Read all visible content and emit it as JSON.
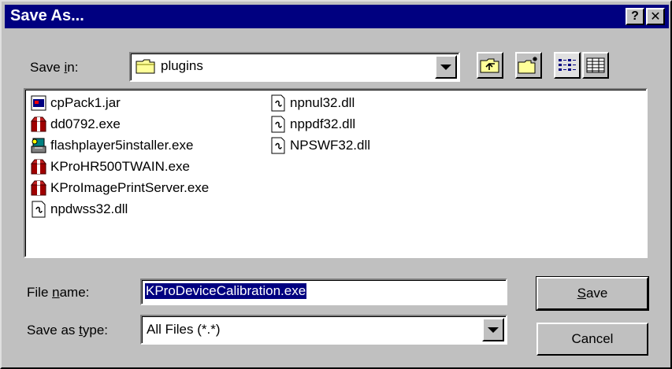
{
  "window": {
    "title": "Save As...",
    "help_button": "?",
    "close_button": "✕"
  },
  "save_in": {
    "label_pre": "Save ",
    "label_mnemonic": "i",
    "label_post": "n:",
    "folder": "plugins",
    "folder_icon": "folder-icon"
  },
  "toolbar": [
    {
      "name": "up-one-level-button",
      "icon": "up-folder-icon"
    },
    {
      "name": "create-new-folder-button",
      "icon": "new-folder-icon"
    },
    {
      "name": "list-view-button",
      "icon": "list-view-icon"
    },
    {
      "name": "details-view-button",
      "icon": "details-view-icon"
    }
  ],
  "files": [
    {
      "name": "cpPack1.jar",
      "icon": "jar-icon"
    },
    {
      "name": "dd0792.exe",
      "icon": "package-icon"
    },
    {
      "name": "flashplayer5installer.exe",
      "icon": "installer-icon"
    },
    {
      "name": "KProHR500TWAIN.exe",
      "icon": "package-icon"
    },
    {
      "name": "KProImagePrintServer.exe",
      "icon": "package-icon"
    },
    {
      "name": "npdwss32.dll",
      "icon": "dll-icon"
    },
    {
      "name": "npnul32.dll",
      "icon": "dll-icon"
    },
    {
      "name": "nppdf32.dll",
      "icon": "dll-icon"
    },
    {
      "name": "NPSWF32.dll",
      "icon": "dll-icon"
    }
  ],
  "file_name": {
    "label_pre": "File ",
    "label_mnemonic": "n",
    "label_post": "ame:",
    "value": "KProDeviceCalibration.exe"
  },
  "save_as_type": {
    "label_pre": "Save as ",
    "label_mnemonic": "t",
    "label_post": "ype:",
    "value": "All Files (*.*)"
  },
  "buttons": {
    "save_mnemonic": "S",
    "save_rest": "ave",
    "cancel": "Cancel"
  }
}
